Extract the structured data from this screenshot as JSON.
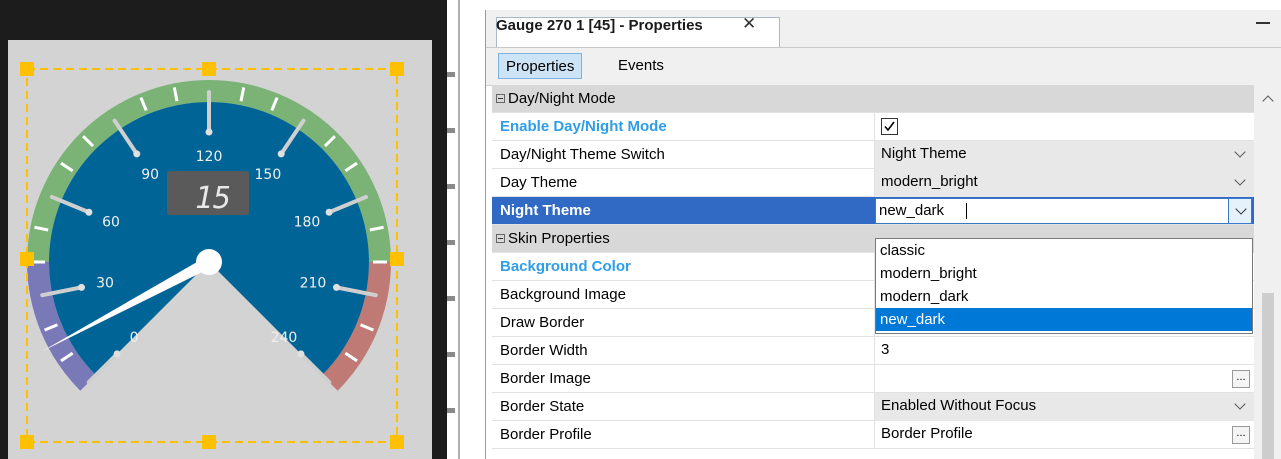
{
  "gauge": {
    "scale_labels": [
      "0",
      "30",
      "60",
      "90",
      "120",
      "150",
      "180",
      "210",
      "240"
    ],
    "digital_value": "15",
    "needle_value": 15,
    "colors": {
      "face": "#006497",
      "ring_green": "#7bb377",
      "ring_red": "#c07a76",
      "ring_purple": "#7a79b8",
      "handle": "#ffc000"
    }
  },
  "panel": {
    "title": "Gauge 270 1 [45] - Properties",
    "close_glyph": "✕",
    "tabs": [
      "Properties",
      "Events"
    ]
  },
  "rows": [
    {
      "type": "category",
      "name": "Day/Night Mode"
    },
    {
      "type": "prop",
      "name": "Enable Day/Night Mode",
      "style": "highlight",
      "value": "",
      "editor": "checkbox",
      "checked": true
    },
    {
      "type": "prop",
      "name": "Day/Night Theme Switch",
      "value": "Night Theme",
      "editor": "combo"
    },
    {
      "type": "prop",
      "name": "Day Theme",
      "value": "modern_bright",
      "editor": "combo"
    },
    {
      "type": "prop",
      "name": "Night Theme",
      "value": "new_dark",
      "editor": "edit",
      "selected": true
    },
    {
      "type": "category",
      "name": "Skin Properties"
    },
    {
      "type": "prop",
      "name": "Background Color",
      "style": "highlight",
      "value": ""
    },
    {
      "type": "prop",
      "name": "Background Image",
      "value": ""
    },
    {
      "type": "prop",
      "name": "Draw Border",
      "value": "",
      "editor": "checkbox",
      "checked": true
    },
    {
      "type": "prop",
      "name": "Border Width",
      "value": "3"
    },
    {
      "type": "prop",
      "name": "Border Image",
      "value": "",
      "editor": "ellipsis"
    },
    {
      "type": "prop",
      "name": "Border State",
      "value": "Enabled Without Focus",
      "editor": "combo"
    },
    {
      "type": "prop",
      "name": "Border Profile",
      "value": "Border Profile",
      "editor": "ellipsis"
    }
  ],
  "dropdown": {
    "options": [
      "classic",
      "modern_bright",
      "modern_dark",
      "new_dark"
    ],
    "selected": "new_dark"
  }
}
